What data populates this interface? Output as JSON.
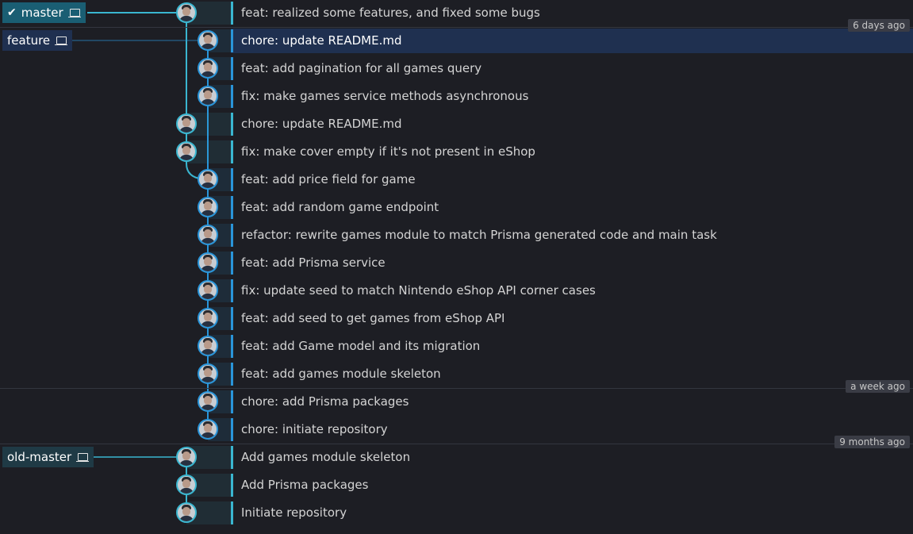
{
  "branches": {
    "master": {
      "label": "master",
      "icon": "laptop-icon",
      "checked": true
    },
    "feature": {
      "label": "feature",
      "icon": "laptop-icon"
    },
    "old_master": {
      "label": "old-master",
      "icon": "laptop-icon"
    }
  },
  "dates": {
    "d1": "6 days ago",
    "d2": "a week ago",
    "d3": "9 months ago"
  },
  "commits": [
    {
      "message": "feat: realized some features, and fixed some bugs"
    },
    {
      "message": "chore: update README.md"
    },
    {
      "message": "feat: add pagination for all games query"
    },
    {
      "message": "fix: make games service methods asynchronous"
    },
    {
      "message": "chore: update README.md"
    },
    {
      "message": "fix: make cover empty if it's not present in eShop"
    },
    {
      "message": "feat: add price field for game"
    },
    {
      "message": "feat: add random game endpoint"
    },
    {
      "message": "refactor: rewrite games module to match Prisma generated code and main task"
    },
    {
      "message": "feat: add Prisma service"
    },
    {
      "message": "fix: update seed to match Nintendo eShop API corner cases"
    },
    {
      "message": "feat: add seed to get games from eShop API"
    },
    {
      "message": "feat: add Game model and its migration"
    },
    {
      "message": "feat: add games module skeleton"
    },
    {
      "message": "chore: add Prisma packages"
    },
    {
      "message": "chore: initiate repository"
    },
    {
      "message": "Add games module skeleton"
    },
    {
      "message": "Add Prisma packages"
    },
    {
      "message": "Initiate repository"
    }
  ],
  "colors": {
    "lane_master": "#3ab6d0",
    "lane_feature": "#2a95d9",
    "selected_row": "#1f3050"
  }
}
